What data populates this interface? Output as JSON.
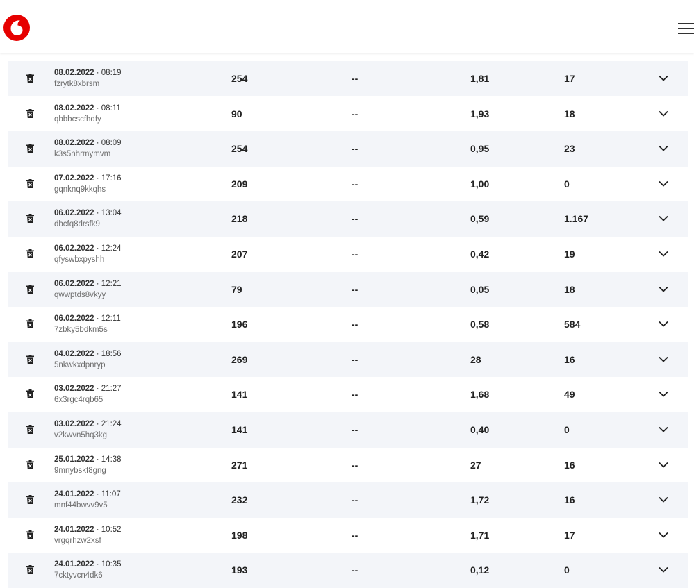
{
  "brand": {
    "logo_icon": "vodafone-logo",
    "accent": "#e60000"
  },
  "header": {
    "menu_icon": "hamburger-menu-icon"
  },
  "rows": [
    {
      "date": "08.02.2022",
      "time": "· 08:19",
      "code": "fzrytk8xbrsm",
      "v1": "254",
      "v2": "--",
      "v3": "1,81",
      "v4": "17"
    },
    {
      "date": "08.02.2022",
      "time": "· 08:11",
      "code": "qbbbcscfhdfy",
      "v1": "90",
      "v2": "--",
      "v3": "1,93",
      "v4": "18"
    },
    {
      "date": "08.02.2022",
      "time": "· 08:09",
      "code": "k3s5nhrmymvm",
      "v1": "254",
      "v2": "--",
      "v3": "0,95",
      "v4": "23"
    },
    {
      "date": "07.02.2022",
      "time": "· 17:16",
      "code": "gqnknq9kkqhs",
      "v1": "209",
      "v2": "--",
      "v3": "1,00",
      "v4": "0"
    },
    {
      "date": "06.02.2022",
      "time": "· 13:04",
      "code": "dbcfq8drsfk9",
      "v1": "218",
      "v2": "--",
      "v3": "0,59",
      "v4": "1.167"
    },
    {
      "date": "06.02.2022",
      "time": "· 12:24",
      "code": "qfyswbxpyshh",
      "v1": "207",
      "v2": "--",
      "v3": "0,42",
      "v4": "19"
    },
    {
      "date": "06.02.2022",
      "time": "· 12:21",
      "code": "qwwptds8vkyy",
      "v1": "79",
      "v2": "--",
      "v3": "0,05",
      "v4": "18"
    },
    {
      "date": "06.02.2022",
      "time": "· 12:11",
      "code": "7zbky5bdkm5s",
      "v1": "196",
      "v2": "--",
      "v3": "0,58",
      "v4": "584"
    },
    {
      "date": "04.02.2022",
      "time": "· 18:56",
      "code": "5nkwkxdpnryp",
      "v1": "269",
      "v2": "--",
      "v3": "28",
      "v4": "16"
    },
    {
      "date": "03.02.2022",
      "time": "· 21:27",
      "code": "6x3rgc4rqb65",
      "v1": "141",
      "v2": "--",
      "v3": "1,68",
      "v4": "49"
    },
    {
      "date": "03.02.2022",
      "time": "· 21:24",
      "code": "v2kwvn5hq3kg",
      "v1": "141",
      "v2": "--",
      "v3": "0,40",
      "v4": "0"
    },
    {
      "date": "25.01.2022",
      "time": "· 14:38",
      "code": "9mnybskf8gng",
      "v1": "271",
      "v2": "--",
      "v3": "27",
      "v4": "16"
    },
    {
      "date": "24.01.2022",
      "time": "· 11:07",
      "code": "mnf44bwvv9v5",
      "v1": "232",
      "v2": "--",
      "v3": "1,72",
      "v4": "16"
    },
    {
      "date": "24.01.2022",
      "time": "· 10:52",
      "code": "vrgqrhzw2xsf",
      "v1": "198",
      "v2": "--",
      "v3": "1,71",
      "v4": "17"
    },
    {
      "date": "24.01.2022",
      "time": "· 10:35",
      "code": "7cktyvcn4dk6",
      "v1": "193",
      "v2": "--",
      "v3": "0,12",
      "v4": "0"
    }
  ]
}
